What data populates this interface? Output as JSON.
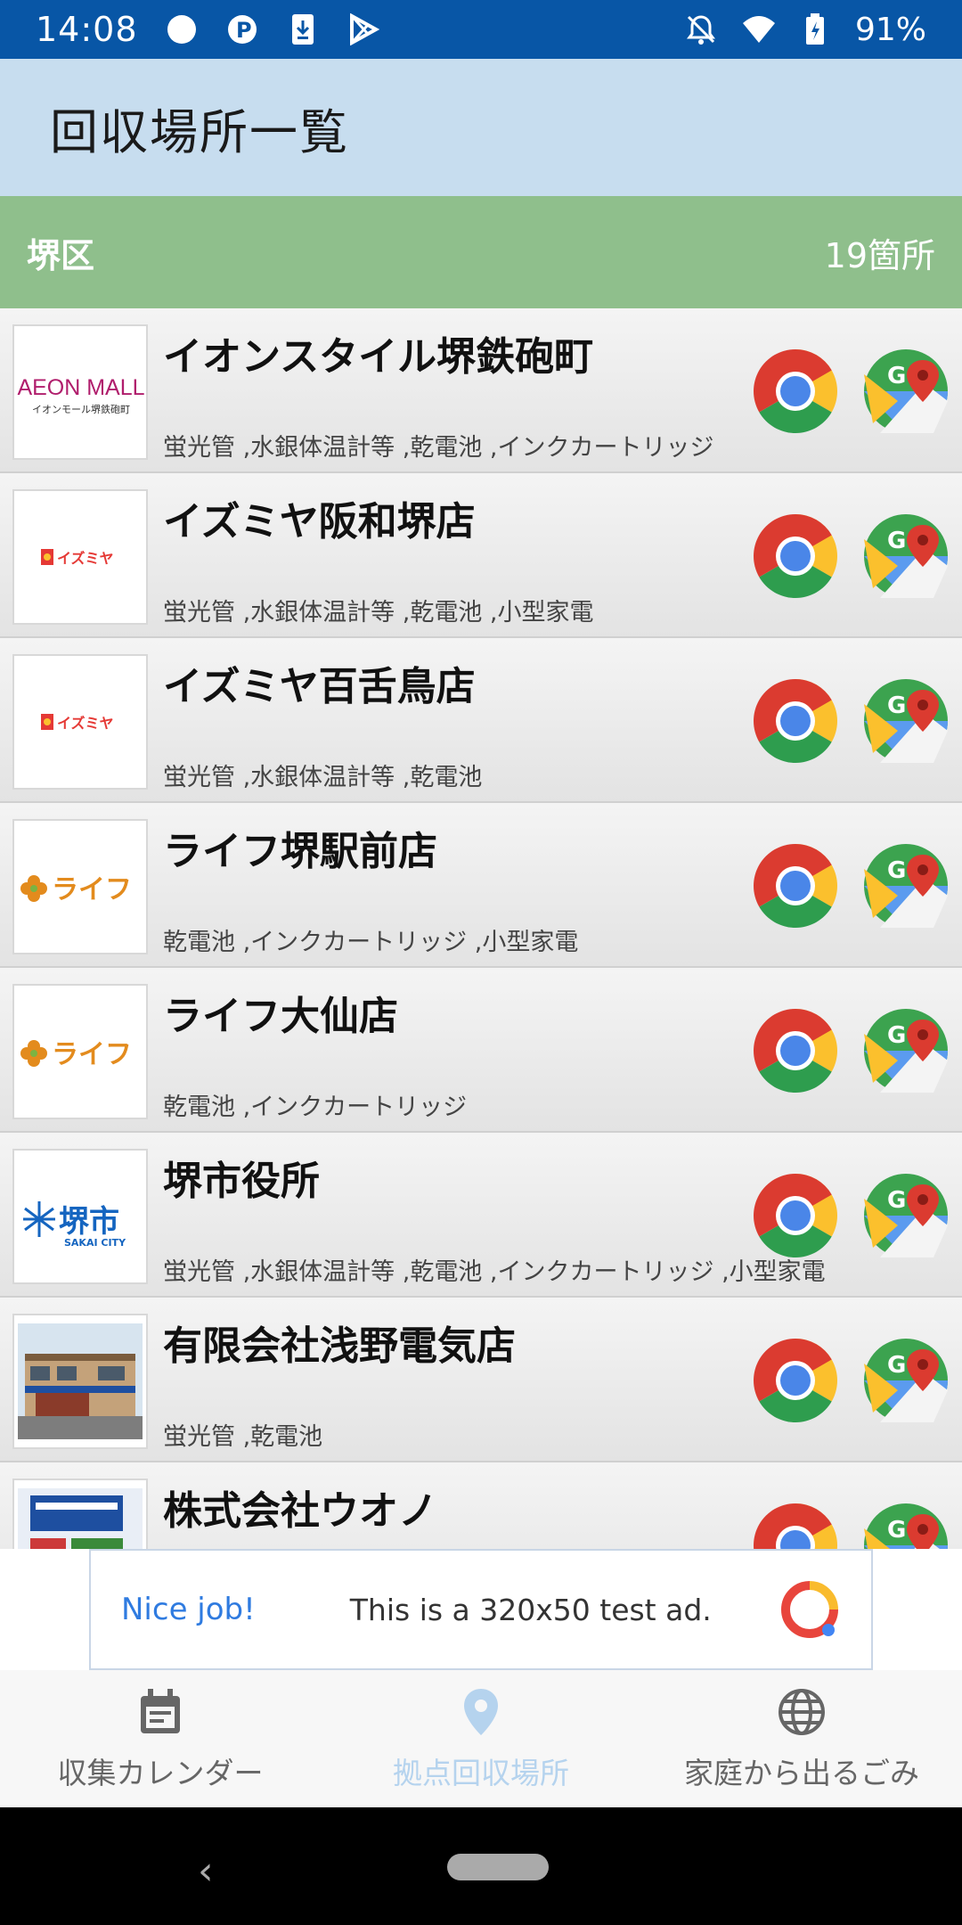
{
  "status_bar": {
    "time": "14:08",
    "battery": "91%",
    "left_icons": [
      "circle-icon",
      "parking-icon",
      "download-icon",
      "play-store-icon"
    ],
    "right_icons": [
      "notifications-off-icon",
      "wifi-icon",
      "battery-icon"
    ]
  },
  "app_bar": {
    "title": "回収場所一覧"
  },
  "ward": {
    "name": "堺区",
    "count": "19箇所"
  },
  "items": [
    {
      "name": "イオンスタイル堺鉄砲町",
      "categories": "蛍光管 ,水銀体温計等 ,乾電池 ,インクカートリッジ",
      "logo": "AEON MALL",
      "logo_sub": "イオンモール堺鉄砲町"
    },
    {
      "name": "イズミヤ阪和堺店",
      "categories": "蛍光管 ,水銀体温計等 ,乾電池 ,小型家電",
      "logo": "イズミヤ"
    },
    {
      "name": "イズミヤ百舌鳥店",
      "categories": "蛍光管 ,水銀体温計等 ,乾電池",
      "logo": "イズミヤ"
    },
    {
      "name": "ライフ堺駅前店",
      "categories": "乾電池 ,インクカートリッジ ,小型家電",
      "logo": "ライフ"
    },
    {
      "name": "ライフ大仙店",
      "categories": "乾電池 ,インクカートリッジ",
      "logo": "ライフ"
    },
    {
      "name": "堺市役所",
      "categories": "蛍光管 ,水銀体温計等 ,乾電池 ,インクカートリッジ ,小型家電",
      "logo": "堺市",
      "logo_sub": "SAKAI CITY"
    },
    {
      "name": "有限会社浅野電気店",
      "categories": "蛍光管 ,乾電池",
      "logo": ""
    },
    {
      "name": "株式会社ウオノ",
      "categories": "",
      "logo": ""
    }
  ],
  "ad": {
    "nice": "Nice job!",
    "text": "This is a 320x50 test ad."
  },
  "bottom_nav": [
    {
      "label": "収集カレンダー",
      "icon": "calendar-icon",
      "active": false
    },
    {
      "label": "拠点回収場所",
      "icon": "location-pin-icon",
      "active": true
    },
    {
      "label": "家庭から出るごみ",
      "icon": "globe-icon",
      "active": false
    }
  ],
  "colors": {
    "status_bar": "#0856a6",
    "app_bar": "#c7ddef",
    "ward_header": "#8fbf8c",
    "nav_active": "#b5d3ee",
    "ad_accent": "#2f7be0"
  }
}
